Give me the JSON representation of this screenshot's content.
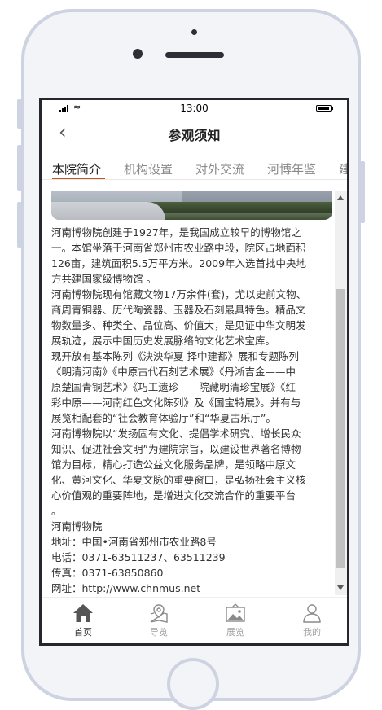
{
  "status_bar": {
    "time": "13:00"
  },
  "header": {
    "back_icon": "chevron-left-icon",
    "title": "参观须知"
  },
  "tabs": [
    {
      "label": "本院简介",
      "active": true
    },
    {
      "label": "机构设置",
      "active": false
    },
    {
      "label": "对外交流",
      "active": false
    },
    {
      "label": "河博年鉴",
      "active": false
    },
    {
      "label": "建",
      "active": false
    }
  ],
  "article": {
    "lines": [
      "河南博物院创建于1927年，是我国成立较早的博物馆之",
      "一。本馆坐落于河南省郑州市农业路中段，院区占地面积",
      "126亩，建筑面积5.5万平方米。2009年入选首批中央地",
      "方共建国家级博物馆 。",
      "河南博物院现有馆藏文物17万余件(套)，尤以史前文物、",
      "商周青铜器、历代陶瓷器、玉器及石刻最具特色。精品文",
      "物数量多、种类全、品位高、价值大，是见证中华文明发",
      "展轨迹，展示中国历史发展脉络的文化艺术宝库。",
      "现开放有基本陈列《泱泱华夏 择中建都》展和专题陈列",
      "《明清河南》《中原古代石刻艺术展》《丹淅吉金——中",
      "原楚国青铜艺术》《巧工遗珍——院藏明清珍宝展》《红",
      "彩中原——河南红色文化陈列》及《国宝特展》。并有与",
      "展览相配套的“社会教育体验厅”和“华夏古乐厅”。",
      "河南博物院以“发扬固有文化、提倡学术研究、增长民众",
      "知识、促进社会文明”为建院宗旨，以建设世界著名博物",
      "馆为目标，精心打造公益文化服务品牌，是领略中原文",
      "化、黄河文化、华夏文脉的重要窗口，是弘扬社会主义核",
      "心价值观的重要阵地，是增进文化交流合作的重要平台",
      "。",
      "河南博物院",
      "地址：中国•河南省郑州市农业路8号",
      "电话：0371-63511237、63511239",
      "传真：0371-63850860",
      "网址：http://www.chnmus.net"
    ]
  },
  "bottom_nav": [
    {
      "label": "首页",
      "icon": "home-icon",
      "active": true
    },
    {
      "label": "导览",
      "icon": "map-pin-icon",
      "active": false
    },
    {
      "label": "展览",
      "icon": "picture-icon",
      "active": false
    },
    {
      "label": "我的",
      "icon": "user-icon",
      "active": false
    }
  ],
  "colors": {
    "accent": "#c05a1c",
    "active_text": "#222222",
    "inactive_text": "#8a8a8a"
  }
}
